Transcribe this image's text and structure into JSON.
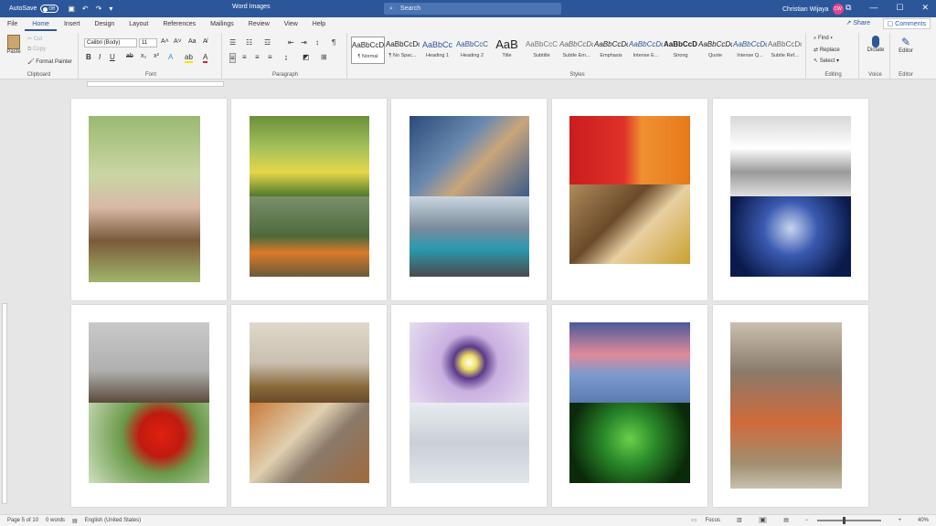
{
  "titlebar": {
    "autosave_label": "AutoSave",
    "autosave_state": "Off",
    "doc_title": "Word Images",
    "search_placeholder": "Search",
    "user_name": "Christian Wijaya",
    "user_initials": "CW"
  },
  "tabs": [
    "File",
    "Home",
    "Insert",
    "Design",
    "Layout",
    "References",
    "Mailings",
    "Review",
    "View",
    "Help"
  ],
  "active_tab": "Home",
  "actions": {
    "share": "Share",
    "comments": "Comments"
  },
  "ribbon": {
    "clipboard": {
      "paste": "Paste",
      "cut": "Cut",
      "copy": "Copy",
      "format_painter": "Format Painter",
      "label": "Clipboard"
    },
    "font": {
      "name": "Calibri (Body)",
      "size": "11",
      "label": "Font"
    },
    "paragraph": {
      "label": "Paragraph"
    },
    "styles": {
      "label": "Styles",
      "items": [
        {
          "preview": "AaBbCcDc",
          "name": "¶ Normal"
        },
        {
          "preview": "AaBbCcDc",
          "name": "¶ No Spac..."
        },
        {
          "preview": "AaBbCc",
          "name": "Heading 1"
        },
        {
          "preview": "AaBbCcC",
          "name": "Heading 2"
        },
        {
          "preview": "AaB",
          "name": "Title"
        },
        {
          "preview": "AaBbCcC",
          "name": "Subtitle"
        },
        {
          "preview": "AaBbCcDc",
          "name": "Subtle Em..."
        },
        {
          "preview": "AaBbCcDc",
          "name": "Emphasis"
        },
        {
          "preview": "AaBbCcDc",
          "name": "Intense E..."
        },
        {
          "preview": "AaBbCcDc",
          "name": "Strong"
        },
        {
          "preview": "AaBbCcDc",
          "name": "Quote"
        },
        {
          "preview": "AaBbCcDc",
          "name": "Intense Q..."
        },
        {
          "preview": "AaBbCcDc",
          "name": "Subtle Ref..."
        }
      ]
    },
    "editing": {
      "find": "Find",
      "replace": "Replace",
      "select": "Select",
      "label": "Editing"
    },
    "voice": {
      "dictate": "Dictate",
      "label": "Voice"
    },
    "editor": {
      "editor": "Editor",
      "label": "Editor"
    }
  },
  "status": {
    "page": "Page 5 of 10",
    "words": "0 words",
    "language": "English (United States)",
    "focus": "Focus",
    "zoom": "40%"
  },
  "colors": {
    "brand": "#2b579a",
    "avatar": "#e0458a"
  }
}
